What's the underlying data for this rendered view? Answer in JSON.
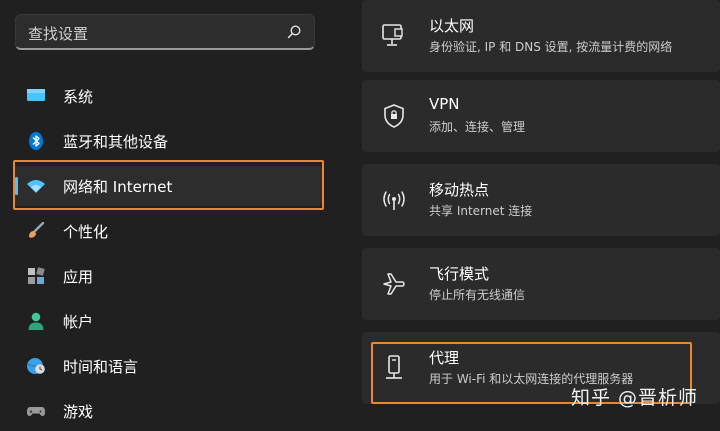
{
  "search": {
    "placeholder": "查找设置",
    "icon": "search-icon"
  },
  "sidebar": {
    "items": [
      {
        "label": "系统",
        "icon": "display-icon",
        "color": "#4cc2ff"
      },
      {
        "label": "蓝牙和其他设备",
        "icon": "bluetooth-icon",
        "color": "#0078d4"
      },
      {
        "label": "网络和 Internet",
        "icon": "wifi-icon",
        "color": "#4cc2ff",
        "selected": true
      },
      {
        "label": "个性化",
        "icon": "brush-icon",
        "color": "#e8a15a"
      },
      {
        "label": "应用",
        "icon": "apps-icon",
        "color": "#b0b0b0"
      },
      {
        "label": "帐户",
        "icon": "account-icon",
        "color": "#3fc79a"
      },
      {
        "label": "时间和语言",
        "icon": "globe-clock-icon",
        "color": "#3aa0e8"
      },
      {
        "label": "游戏",
        "icon": "gamepad-icon",
        "color": "#9a9a9a"
      }
    ]
  },
  "main": {
    "cards": [
      {
        "title": "以太网",
        "subtitle": "身份验证, IP 和 DNS 设置, 按流量计费的网络",
        "icon": "ethernet-icon"
      },
      {
        "title": "VPN",
        "subtitle": "添加、连接、管理",
        "icon": "shield-icon"
      },
      {
        "title": "移动热点",
        "subtitle": "共享 Internet 连接",
        "icon": "hotspot-icon"
      },
      {
        "title": "飞行模式",
        "subtitle": "停止所有无线通信",
        "icon": "airplane-icon"
      },
      {
        "title": "代理",
        "subtitle": "用于 Wi-Fi 和以太网连接的代理服务器",
        "icon": "proxy-icon"
      }
    ]
  },
  "watermark": "知乎 @晋析师",
  "colors": {
    "accent": "#4cc2ff",
    "highlight": "#e8892f",
    "background": "#202020",
    "card": "#2b2b2b"
  }
}
